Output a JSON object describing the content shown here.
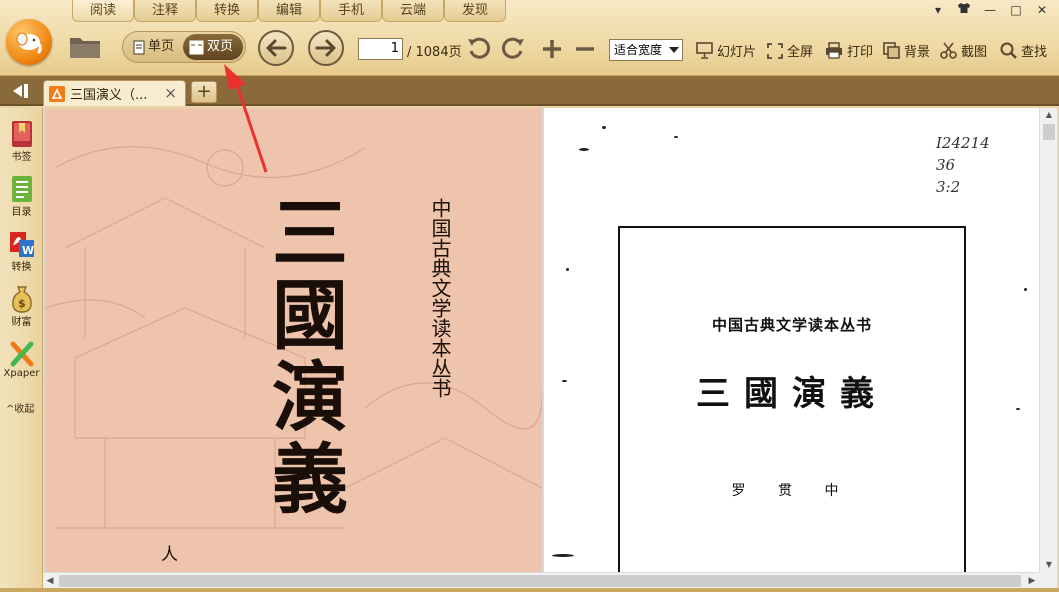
{
  "menu": {
    "tabs": [
      "阅读",
      "注释",
      "转换",
      "编辑",
      "手机",
      "云端",
      "发现"
    ]
  },
  "window_controls": {
    "menu": "▾",
    "skin": "👕",
    "minimize": "—",
    "maximize": "□",
    "close": "✕"
  },
  "toolbar": {
    "single_page": "单页",
    "double_page": "双页",
    "page_current": "1",
    "page_total": "/ 1084页",
    "zoom_mode": "适合宽度",
    "slideshow": "幻灯片",
    "fullscreen": "全屏",
    "print": "打印",
    "background": "背景",
    "screenshot": "截图",
    "find": "查找"
  },
  "tabstrip": {
    "doc_tab_title": "三国演义（...",
    "close": "×",
    "new_tab": "+"
  },
  "sidebar": {
    "items": [
      {
        "label": "书签",
        "icon": "bookmark-icon"
      },
      {
        "label": "目录",
        "icon": "toc-icon"
      },
      {
        "label": "转换",
        "icon": "pdf-convert-icon"
      },
      {
        "label": "财富",
        "icon": "money-bag-icon"
      },
      {
        "label": "Xpaper",
        "icon": "xpaper-icon"
      }
    ],
    "collapse": "^收起"
  },
  "document": {
    "left_page": {
      "cover_title": "三國演義",
      "series": "中国古典文学读本丛书",
      "publisher_fragment": "人"
    },
    "right_page": {
      "stamp": [
        "I24214",
        "36",
        "3:2"
      ],
      "series": "中国古典文学读本丛书",
      "title": "三國演義",
      "author": "罗 贯 中"
    }
  },
  "colors": {
    "accent": "#f08a14",
    "chrome": "#efd9a5",
    "tabstrip": "#8a6a3a",
    "cover": "#efc4ad",
    "annotation_arrow": "#e8322b"
  }
}
